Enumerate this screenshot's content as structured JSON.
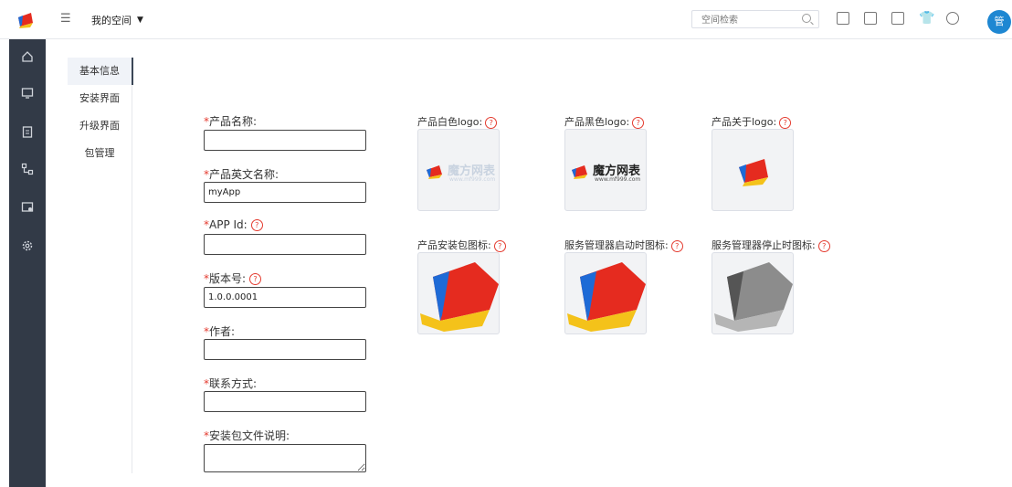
{
  "header": {
    "space_label": "我的空间",
    "search_placeholder": "空间检索",
    "avatar_text": "管"
  },
  "subnav": {
    "items": [
      {
        "label": "基本信息",
        "active": true
      },
      {
        "label": "安装界面",
        "active": false
      },
      {
        "label": "升级界面",
        "active": false
      },
      {
        "label": "包管理",
        "active": false
      }
    ]
  },
  "form": {
    "required_mark": "*",
    "help_mark": "?",
    "fields": [
      {
        "label": "产品名称:",
        "value": "",
        "help": false
      },
      {
        "label": "产品英文名称:",
        "value": "myApp",
        "help": false
      },
      {
        "label": "APP Id:",
        "value": "",
        "help": true
      },
      {
        "label": "版本号:",
        "value": "1.0.0.0001",
        "help": true
      },
      {
        "label": "作者:",
        "value": "",
        "help": false
      },
      {
        "label": "联系方式:",
        "value": "",
        "help": false
      },
      {
        "label": "安装包文件说明:",
        "value": "",
        "help": false
      }
    ]
  },
  "images": [
    {
      "label": "产品白色logo:"
    },
    {
      "label": "产品黑色logo:"
    },
    {
      "label": "产品关于logo:"
    },
    {
      "label": "产品安装包图标:"
    },
    {
      "label": "服务管理器启动时图标:"
    },
    {
      "label": "服务管理器停止时图标:"
    }
  ],
  "brand": {
    "name": "魔方网表",
    "url": "www.mf999.com"
  },
  "colors": {
    "sidebar": "#323a47",
    "accent": "#1e87d2",
    "required": "#e43b2f"
  }
}
